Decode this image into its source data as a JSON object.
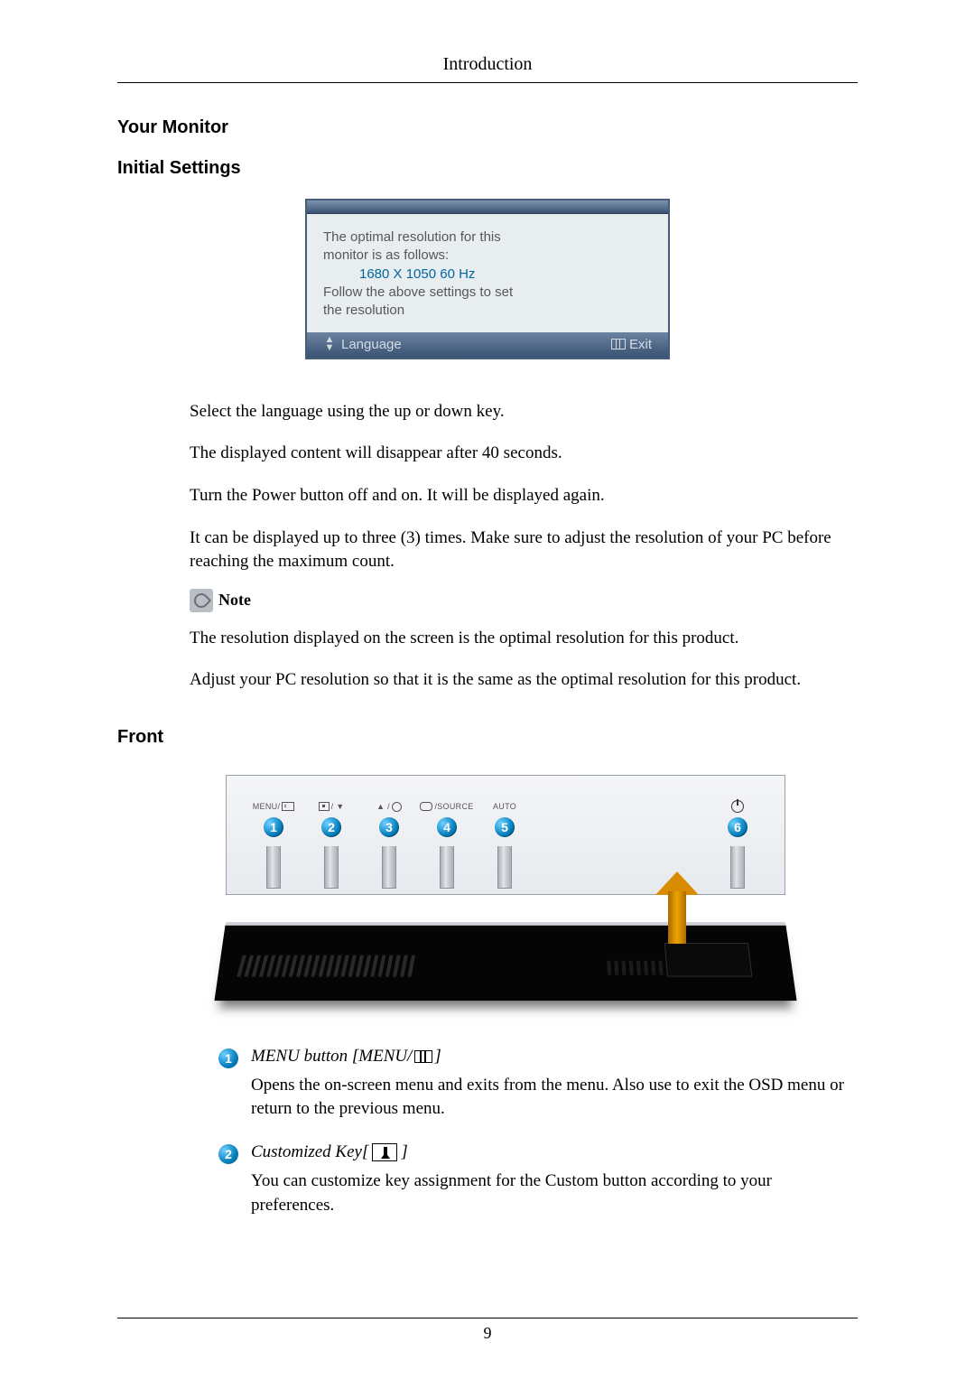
{
  "header": {
    "title": "Introduction"
  },
  "sections": {
    "your_monitor": "Your Monitor",
    "initial_settings": "Initial Settings",
    "front": "Front"
  },
  "osd": {
    "line1": "The optimal resolution for this",
    "line2": "monitor is as follows:",
    "resolution": "1680 X 1050 60 Hz",
    "line3": "Follow the above settings to set",
    "line4": "the resolution",
    "language_label": "Language",
    "exit_label": "Exit"
  },
  "paragraphs": {
    "p1": "Select the language using the up or down key.",
    "p2": "The displayed content will disappear after 40 seconds.",
    "p3": "Turn the Power button off and on. It will be displayed again.",
    "p4": "It can be displayed up to three (3) times. Make sure to adjust the resolution of your PC before reaching the maximum count.",
    "note_label": "Note",
    "p5": "The resolution displayed on the screen is the optimal resolution for this product.",
    "p6": "Adjust your PC resolution so that it is the same as the optimal resolution for this product."
  },
  "front_buttons": {
    "b1": {
      "num": "1",
      "label_left": "MENU/"
    },
    "b2": {
      "num": "2",
      "label_right": "/ ▼"
    },
    "b3": {
      "num": "3",
      "label": "▲ /"
    },
    "b4": {
      "num": "4",
      "label_right": "/SOURCE"
    },
    "b5": {
      "num": "5",
      "label": "AUTO"
    },
    "b6": {
      "num": "6"
    }
  },
  "front_desc": {
    "item1": {
      "num": "1",
      "title_prefix": "MENU button [MENU/",
      "title_suffix": "]",
      "desc": "Opens the on-screen menu and exits from the menu. Also use to exit the OSD menu or return to the previous menu."
    },
    "item2": {
      "num": "2",
      "title_prefix": "Customized Key[",
      "title_suffix": "]",
      "desc": "You can customize key assignment for the Custom button according to your preferences."
    }
  },
  "page_number": "9"
}
